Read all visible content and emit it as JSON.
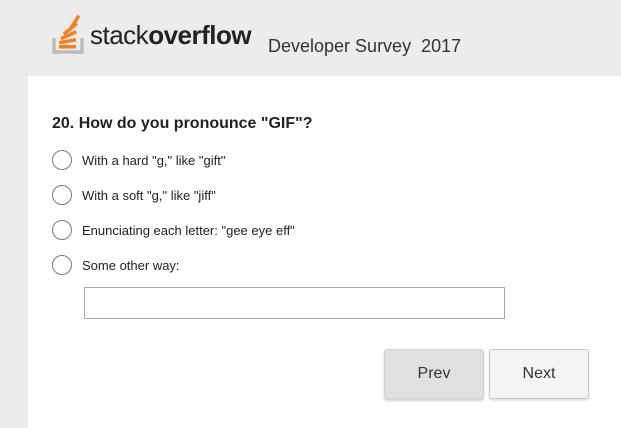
{
  "header": {
    "logo": {
      "text_light": "stack",
      "text_bold": "overflow",
      "icon": "stackoverflow-logo-icon",
      "accent_color": "#f48024",
      "tray_color": "#bcbbbb"
    },
    "survey_title": "Developer Survey  2017"
  },
  "question": {
    "text": "20. How do you pronounce \"GIF\"?",
    "options": [
      {
        "label": "With a hard \"g,\" like \"gift\"",
        "selected": false
      },
      {
        "label": "With a soft \"g,\" like \"jiff\"",
        "selected": false
      },
      {
        "label": "Enunciating each letter: \"gee eye eff\"",
        "selected": false
      },
      {
        "label": "Some other way:",
        "selected": false
      }
    ],
    "other_input": {
      "value": "",
      "placeholder": ""
    }
  },
  "navigation": {
    "prev_label": "Prev",
    "next_label": "Next"
  }
}
